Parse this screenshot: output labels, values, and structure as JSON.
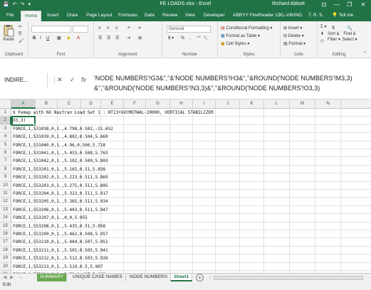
{
  "window": {
    "title": "FE LOADS.xlsx - Excel",
    "user": "Richard Abbott",
    "controls": {
      "minimize": "—",
      "restore": "❐",
      "close": "✕",
      "options": "⊡"
    },
    "qat": {
      "save": "💾",
      "undo": "↶",
      "redo": "↷",
      "more": "▾"
    }
  },
  "ribbon_tabs": [
    "File",
    "Home",
    "Insert",
    "Draw",
    "Page Layout",
    "Formulas",
    "Data",
    "Review",
    "View",
    "Developer",
    "ABBYY FineReader 12",
    "XL-VIKING",
    "T. R. S."
  ],
  "active_tab": "Home",
  "tell_me": "Tell me",
  "ribbon": {
    "clipboard": {
      "paste": "Paste",
      "label": "Clipboard"
    },
    "font": {
      "label": "Font",
      "bold": "B",
      "italic": "I",
      "underline": "U"
    },
    "alignment": {
      "label": "Alignment"
    },
    "number": {
      "format": "General",
      "label": "Number",
      "currency": "$ ▾",
      "percent": "%",
      "comma": ","
    },
    "styles": {
      "cond": "Conditional Formatting ▾",
      "table": "Format as Table ▾",
      "cell": "Cell Styles ▾",
      "label": "Styles"
    },
    "cells": {
      "insert": "Insert ▾",
      "delete": "Delete ▾",
      "format": "Format ▾",
      "label": "Cells"
    },
    "editing": {
      "sum": "Σ ▾",
      "sort": "Sort &",
      "filter": "Filter ▾",
      "find": "Find &",
      "select": "Select ▾",
      "label": "Editing"
    }
  },
  "formula_bar": {
    "name_box": "INDIRE...",
    "cancel": "✕",
    "enter": "✓",
    "fx": "fx",
    "content": "'NODE NUMBERS'!G3&\",\"&'NODE NUMBERS'!H3&\",\"&ROUND('NODE NUMBERS'!M3,3)&\",\"&ROUND('NODE NUMBERS'!N3,3)&\",\"&ROUND('NODE NUMBERS'!O3,3)"
  },
  "columns": [
    "A",
    "B",
    "C",
    "D",
    "E",
    "F",
    "G",
    "H",
    "I",
    "J",
    "K",
    "L",
    "M",
    "N"
  ],
  "active_column": "A",
  "active_row": "2",
  "rows": [
    {
      "n": "1",
      "text": "$ Femap with NX Nastran Load Set 1 : HT13+GVCMOTWAL-20000, VERTICAL STABILIZER"
    },
    {
      "n": "2",
      "text": "O3,3)"
    },
    {
      "n": "3",
      "text": "FORCE,1,531038,0,1.,4.798,0.502,-21.652"
    },
    {
      "n": "4",
      "text": "FORCE,1,531039,0,1.,4.882,0.504,5.669"
    },
    {
      "n": "5",
      "text": "FORCE,1,531040,0,1.,4.96,0.506,5.718"
    },
    {
      "n": "6",
      "text": "FORCE,1,531041,0,1.,5.033,0.508,5.763"
    },
    {
      "n": "7",
      "text": "FORCE,1,531042,0,1.,5.102,0.509,5.803"
    },
    {
      "n": "8",
      "text": "FORCE,1,553201,0,1.,5.165,0.51,5.838"
    },
    {
      "n": "9",
      "text": "FORCE,1,553202,0,1.,5.223,0.511,5.869"
    },
    {
      "n": "10",
      "text": "FORCE,1,553203,0,1.,5.275,0.511,5.895"
    },
    {
      "n": "11",
      "text": "FORCE,1,553204,0,1.,5.323,0.511,5.917"
    },
    {
      "n": "12",
      "text": "FORCE,1,553205,0,1.,5.365,0.511,5.934"
    },
    {
      "n": "13",
      "text": "FORCE,1,553206,0,1.,5.403,0.511,5.947"
    },
    {
      "n": "14",
      "text": "FORCE,1,553207,0,1.,0,0,5.955"
    },
    {
      "n": "15",
      "text": "FORCE,1,553208,0,1.,5.435,0.51,5.958"
    },
    {
      "n": "16",
      "text": "FORCE,1,553209,0,1.,5.462,0.508,5.957"
    },
    {
      "n": "17",
      "text": "FORCE,1,553210,0,1.,5.484,0.507,5.951"
    },
    {
      "n": "18",
      "text": "FORCE,1,553211,0,1.,5.501,0.505,5.941"
    },
    {
      "n": "19",
      "text": "FORCE,1,553212,0,1.,5.512,0.503,5.926"
    },
    {
      "n": "20",
      "text": "FORCE,1,553213,0,1.,5.519,0.5,5.907"
    },
    {
      "n": "21",
      "text": "FORCE,1,553214,0,1.,5.52,0.497,5.883"
    },
    {
      "n": "22",
      "text": "FORCE,1,553215,0,1.,5.516,0.494,5.854"
    },
    {
      "n": "23",
      "text": "FORCE,1,553216,0,1.,5.508,0.49,5.821"
    }
  ],
  "sheet_tabs": [
    "SUMMARY",
    "UNIQUE CASE NAMES",
    "NODE NUMBERS",
    "Sheet1"
  ],
  "active_sheet": "Sheet1",
  "sheet_nav": {
    "prev": "◀",
    "next": "▶",
    "more": "...",
    "add": "+"
  },
  "status": "Edit",
  "colors": {
    "excel_green": "#217346",
    "summary_tab": "#6aa84f"
  }
}
